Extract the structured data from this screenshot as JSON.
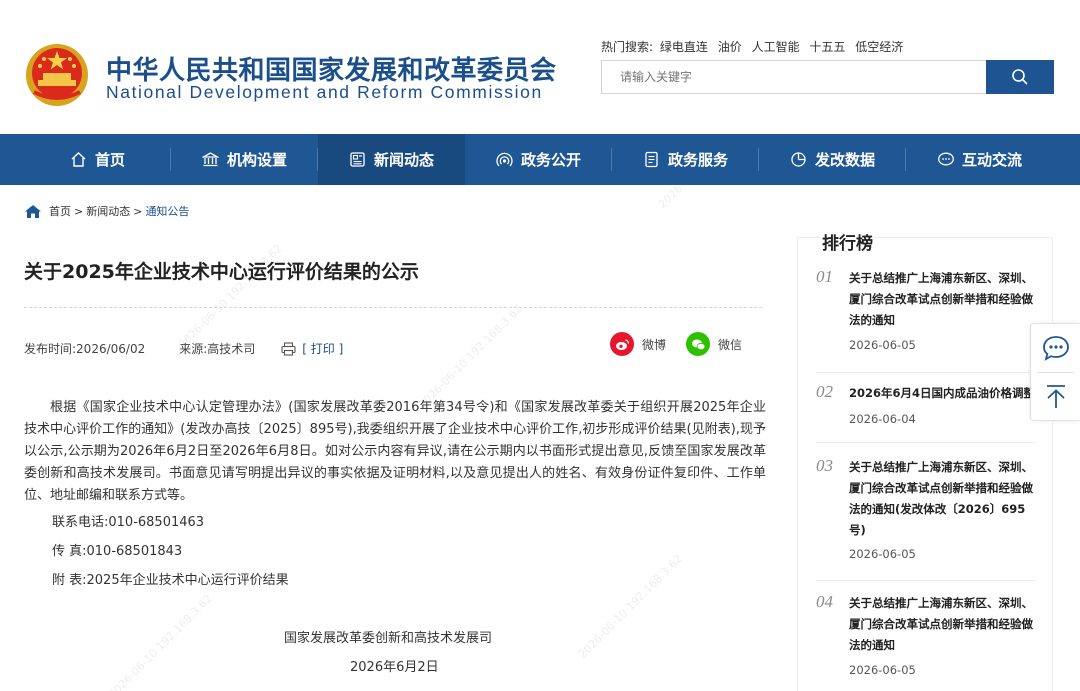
{
  "header": {
    "title_cn": "中华人民共和国国家发展和改革委员会",
    "title_en": "National Development and Reform Commission",
    "hot_label": "热门搜索:",
    "hot_terms": [
      "绿电直连",
      "油价",
      "人工智能",
      "十五五",
      "低空经济"
    ],
    "search_placeholder": "请输入关键字"
  },
  "nav": {
    "items": [
      {
        "label": "首页",
        "icon": "home-icon"
      },
      {
        "label": "机构设置",
        "icon": "institution-icon"
      },
      {
        "label": "新闻动态",
        "icon": "news-icon"
      },
      {
        "label": "政务公开",
        "icon": "broadcast-icon"
      },
      {
        "label": "政务服务",
        "icon": "document-icon"
      },
      {
        "label": "发改数据",
        "icon": "pie-chart-icon"
      },
      {
        "label": "互动交流",
        "icon": "chat-icon"
      }
    ],
    "active_index": 2
  },
  "breadcrumb": {
    "items": [
      "首页",
      "新闻动态",
      "通知公告"
    ],
    "separator": ">"
  },
  "article": {
    "title": "关于2025年企业技术中心运行评价结果的公示",
    "publish_time": "发布时间:2026/06/02",
    "source": "来源:高技术司",
    "print_label": "[ 打印 ]",
    "share": [
      {
        "label": "微博",
        "icon": "weibo-icon",
        "color": "#e6162d"
      },
      {
        "label": "微信",
        "icon": "wechat-icon",
        "color": "#2dc100"
      }
    ],
    "paragraph": "根据《国家企业技术中心认定管理办法》(国家发展改革委2016年第34号令)和《国家发展改革委关于组织开展2025年企业技术中心评价工作的通知》(发改办高技〔2025〕895号),我委组织开展了企业技术中心评价工作,初步形成评价结果(见附表),现予以公示,公示期为2026年6月2日至2026年6月8日。如对公示内容有异议,请在公示期内以书面形式提出意见,反馈至国家发展改革委创新和高技术发展司。书面意见请写明提出异议的事实依据及证明材料,以及意见提出人的姓名、有效身份证件复印件、工作单位、地址邮编和联系方式等。",
    "phone": "联系电话:010-68501463",
    "fax": "传 真:010-68501843",
    "attachment": "附 表:2025年企业技术中心运行评价结果",
    "signature": "国家发展改革委创新和高技术发展司",
    "date": "2026年6月2日"
  },
  "sidebar": {
    "title": "排行榜",
    "items": [
      {
        "num": "01",
        "title": "关于总结推广上海浦东新区、深圳、厦门综合改革试点创新举措和经验做法的通知",
        "date": "2026-06-05"
      },
      {
        "num": "02",
        "title": "2026年6月4日国内成品油价格调整",
        "date": "2026-06-04"
      },
      {
        "num": "03",
        "title": "关于总结推广上海浦东新区、深圳、厦门综合改革试点创新举措和经验做法的通知(发改体改〔2026〕695号)",
        "date": "2026-06-05"
      },
      {
        "num": "04",
        "title": "关于总结推广上海浦东新区、深圳、厦门综合改革试点创新举措和经验做法的通知",
        "date": "2026-06-05"
      }
    ]
  },
  "colors": {
    "brand_blue": "#1f5795",
    "nav_active": "#184a80",
    "title_blue": "#1b4f8c"
  }
}
